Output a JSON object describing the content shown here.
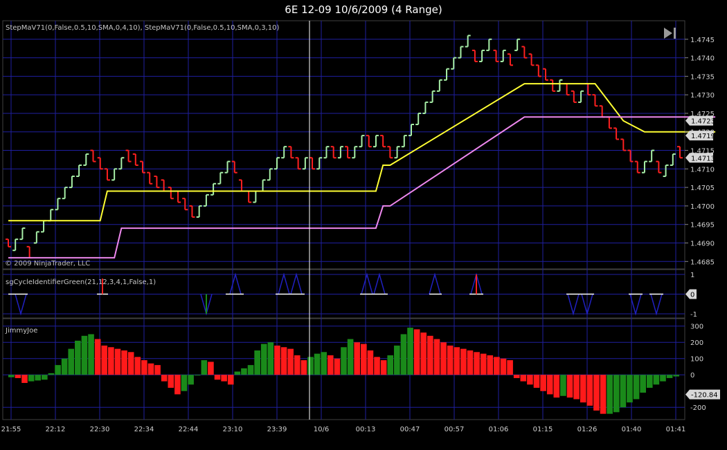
{
  "window": {
    "title": "6E 12-09  10/6/2009 (4 Range)"
  },
  "copyright": "© 2009 NinjaTrader, LLC",
  "colors": {
    "background": "#000000",
    "grid": "#1f1fa0",
    "up_bar": "#a8f0a8",
    "down_bar": "#ff2020",
    "step_fast": "#ffff33",
    "step_slow": "#ee88ee",
    "hist_up": "#1a8a1a",
    "hist_down": "#ff1a1a",
    "cycle": "#2020c0"
  },
  "icons": {
    "scroll_end": "skip-to-end-icon"
  },
  "chart_data": [
    {
      "type": "line",
      "panel": "price",
      "indicator_label": "StepMaV71(0,False,0.5,10,SMA,0,4,10), StepMaV71(0,False,0.5,10,SMA,0,3,10)",
      "ylim": [
        1.4683,
        1.475
      ],
      "y_ticks": [
        "1.4745",
        "1.4740",
        "1.4735",
        "1.4730",
        "1.4725",
        "1.4720",
        "1.4715",
        "1.4710",
        "1.4705",
        "1.4700",
        "1.4695",
        "1.4690",
        "1.4685"
      ],
      "x_ticks": [
        "21:55",
        "22:12",
        "22:30",
        "22:34",
        "22:44",
        "23:10",
        "23:39",
        "10/6",
        "00:13",
        "00:47",
        "00:57",
        "01:06",
        "01:15",
        "01:26",
        "01:40",
        "01:41"
      ],
      "series": [
        {
          "kind": "bars",
          "values": [
            [
              1.4691,
              1.4689
            ],
            [
              1.4688,
              1.4691
            ],
            [
              1.4691,
              1.4694
            ],
            [
              1.4689,
              1.4686
            ],
            [
              1.469,
              1.4693
            ],
            [
              1.4693,
              1.4696
            ],
            [
              1.4696,
              1.4699
            ],
            [
              1.4699,
              1.4702
            ],
            [
              1.4702,
              1.4705
            ],
            [
              1.4705,
              1.4708
            ],
            [
              1.4708,
              1.4711
            ],
            [
              1.4711,
              1.4714
            ],
            [
              1.4715,
              1.4712
            ],
            [
              1.4713,
              1.471
            ],
            [
              1.471,
              1.4707
            ],
            [
              1.4707,
              1.471
            ],
            [
              1.471,
              1.4713
            ],
            [
              1.4715,
              1.4712
            ],
            [
              1.4714,
              1.4711
            ],
            [
              1.4712,
              1.4709
            ],
            [
              1.4709,
              1.4706
            ],
            [
              1.4708,
              1.4705
            ],
            [
              1.4707,
              1.4704
            ],
            [
              1.4705,
              1.4702
            ],
            [
              1.4704,
              1.4701
            ],
            [
              1.4702,
              1.4699
            ],
            [
              1.47,
              1.4697
            ],
            [
              1.4697,
              1.47
            ],
            [
              1.47,
              1.4703
            ],
            [
              1.4703,
              1.4706
            ],
            [
              1.4706,
              1.4709
            ],
            [
              1.4709,
              1.4712
            ],
            [
              1.4712,
              1.4709
            ],
            [
              1.4707,
              1.4704
            ],
            [
              1.4704,
              1.4701
            ],
            [
              1.4701,
              1.4704
            ],
            [
              1.4704,
              1.4707
            ],
            [
              1.4707,
              1.471
            ],
            [
              1.471,
              1.4713
            ],
            [
              1.4713,
              1.4716
            ],
            [
              1.4716,
              1.4713
            ],
            [
              1.4713,
              1.471
            ],
            [
              1.471,
              1.4713
            ],
            [
              1.4713,
              1.471
            ],
            [
              1.471,
              1.4713
            ],
            [
              1.4713,
              1.4716
            ],
            [
              1.4716,
              1.4713
            ],
            [
              1.4713,
              1.4716
            ],
            [
              1.4716,
              1.4713
            ],
            [
              1.4713,
              1.4716
            ],
            [
              1.4716,
              1.4719
            ],
            [
              1.4719,
              1.4716
            ],
            [
              1.4716,
              1.4719
            ],
            [
              1.4719,
              1.4716
            ],
            [
              1.4716,
              1.4713
            ],
            [
              1.4713,
              1.4716
            ],
            [
              1.4716,
              1.4719
            ],
            [
              1.4719,
              1.4722
            ],
            [
              1.4722,
              1.4725
            ],
            [
              1.4725,
              1.4728
            ],
            [
              1.4728,
              1.4731
            ],
            [
              1.4731,
              1.4734
            ],
            [
              1.4734,
              1.4737
            ],
            [
              1.4737,
              1.474
            ],
            [
              1.474,
              1.4743
            ],
            [
              1.4743,
              1.4746
            ],
            [
              1.4742,
              1.4739
            ],
            [
              1.4739,
              1.4742
            ],
            [
              1.4742,
              1.4745
            ],
            [
              1.4742,
              1.4739
            ],
            [
              1.4739,
              1.4742
            ],
            [
              1.4741,
              1.4738
            ],
            [
              1.4742,
              1.4745
            ],
            [
              1.4743,
              1.474
            ],
            [
              1.4741,
              1.4738
            ],
            [
              1.4738,
              1.4735
            ],
            [
              1.4737,
              1.4734
            ],
            [
              1.4734,
              1.4731
            ],
            [
              1.4731,
              1.4734
            ],
            [
              1.4733,
              1.473
            ],
            [
              1.4731,
              1.4728
            ],
            [
              1.4728,
              1.4731
            ],
            [
              1.4733,
              1.473
            ],
            [
              1.473,
              1.4727
            ],
            [
              1.4727,
              1.4724
            ],
            [
              1.4724,
              1.4721
            ],
            [
              1.4721,
              1.4718
            ],
            [
              1.4718,
              1.4715
            ],
            [
              1.4715,
              1.4712
            ],
            [
              1.4712,
              1.4709
            ],
            [
              1.4709,
              1.4712
            ],
            [
              1.4712,
              1.4715
            ],
            [
              1.4712,
              1.4709
            ],
            [
              1.4708,
              1.4711
            ],
            [
              1.4711,
              1.4714
            ],
            [
              1.4716,
              1.4713
            ]
          ]
        },
        {
          "name": "StepMaV71 fast",
          "kind": "line",
          "x": [
            0,
            13,
            14,
            15,
            52,
            53,
            54,
            73,
            82,
            83,
            87,
            90,
            91,
            100
          ],
          "values": [
            1.4696,
            1.4696,
            1.4704,
            1.4704,
            1.4704,
            1.4711,
            1.4711,
            1.4733,
            1.4733,
            1.4733,
            1.4723,
            1.472,
            1.472,
            1.472
          ]
        },
        {
          "name": "StepMaV71 slow",
          "kind": "line",
          "x": [
            0,
            15,
            16,
            17,
            52,
            53,
            54,
            73,
            74,
            100
          ],
          "values": [
            1.4686,
            1.4686,
            1.4694,
            1.4694,
            1.4694,
            1.47,
            1.47,
            1.4724,
            1.4724,
            1.4724
          ]
        }
      ],
      "price_markers": [
        "1.4723",
        "1.4719",
        "1.4713"
      ]
    },
    {
      "type": "line",
      "panel": "cycle",
      "indicator_label": "sgCycleIdentifierGreen(21,12,3,4,1,False,1)",
      "ylim": [
        -1,
        1
      ],
      "y_ticks": [
        "1",
        "0",
        "-1"
      ],
      "marker": "0"
    },
    {
      "type": "bar",
      "panel": "histogram",
      "indicator_label": "JimmyJoe",
      "ylim": [
        -250,
        320
      ],
      "y_ticks": [
        "300",
        "200",
        "100",
        "0",
        "-200"
      ],
      "marker": "-120.84",
      "values": [
        -15,
        -20,
        -50,
        -40,
        -35,
        -30,
        10,
        60,
        100,
        160,
        210,
        240,
        250,
        220,
        180,
        170,
        160,
        150,
        140,
        110,
        90,
        70,
        60,
        -40,
        -80,
        -120,
        -100,
        -60,
        0,
        90,
        80,
        -30,
        -40,
        -60,
        20,
        40,
        60,
        150,
        190,
        200,
        180,
        170,
        160,
        120,
        90,
        110,
        130,
        140,
        120,
        100,
        170,
        220,
        200,
        190,
        150,
        110,
        90,
        120,
        180,
        250,
        290,
        280,
        260,
        240,
        220,
        200,
        180,
        170,
        160,
        150,
        140,
        130,
        120,
        110,
        100,
        90,
        -20,
        -40,
        -60,
        -80,
        -100,
        -120,
        -140,
        -130,
        -140,
        -150,
        -170,
        -190,
        -220,
        -240,
        -240,
        -230,
        -200,
        -170,
        -150,
        -110,
        -80,
        -60,
        -40,
        -20,
        -10
      ]
    }
  ]
}
